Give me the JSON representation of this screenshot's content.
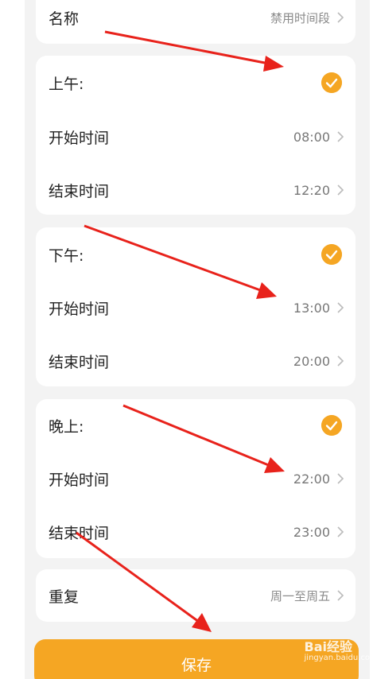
{
  "name_row": {
    "label": "名称",
    "value": "禁用时间段"
  },
  "sections": [
    {
      "title": "上午:",
      "start_label": "开始时间",
      "start_value": "08:00",
      "end_label": "结束时间",
      "end_value": "12:20"
    },
    {
      "title": "下午:",
      "start_label": "开始时间",
      "start_value": "13:00",
      "end_label": "结束时间",
      "end_value": "20:00"
    },
    {
      "title": "晚上:",
      "start_label": "开始时间",
      "start_value": "22:00",
      "end_label": "结束时间",
      "end_value": "23:00"
    }
  ],
  "repeat_row": {
    "label": "重复",
    "value": "周一至周五"
  },
  "save_button": {
    "label": "保存"
  },
  "watermark": {
    "brand": "Bai经验",
    "url": "jingyan.baidu.com"
  },
  "colors": {
    "accent": "#f5a623",
    "annotation_arrow": "#e8221b",
    "background": "#f3f3f3"
  },
  "icons": {
    "check": "checkmark-circle-icon",
    "chevron": "chevron-right-icon"
  }
}
